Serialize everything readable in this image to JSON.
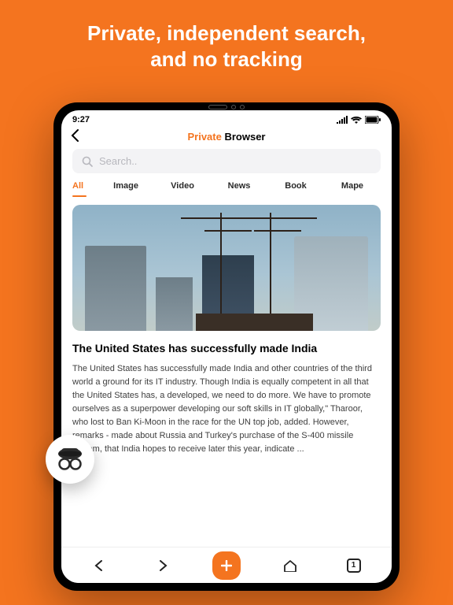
{
  "hero": {
    "line1": "Private, independent search,",
    "line2": "and no tracking"
  },
  "statusbar": {
    "time": "9:27"
  },
  "title": {
    "private": "Private",
    "browser": " Browser"
  },
  "search": {
    "placeholder": "Search.."
  },
  "tabs": [
    "All",
    "Image",
    "Video",
    "News",
    "Book",
    "Mape"
  ],
  "active_tab": 0,
  "article": {
    "headline": "The United States has  successfully made India",
    "body": "The United States has successfully made India  and other countries of the third world a ground  for its IT industry. Though India is equally  competent in all that the United States has, a developed, we need to do more. We have to  promote ourselves as a superpower developing  our soft skills in IT globally,\" Tharoor, who lost  to Ban Ki-Moon in the race for the UN top job,  added. However, remarks - made about Russia  and Turkey's purchase of the S-400 missile  system, that India hopes to receive later this  year, indicate ..."
  },
  "bottombar": {
    "tab_count": "1"
  }
}
